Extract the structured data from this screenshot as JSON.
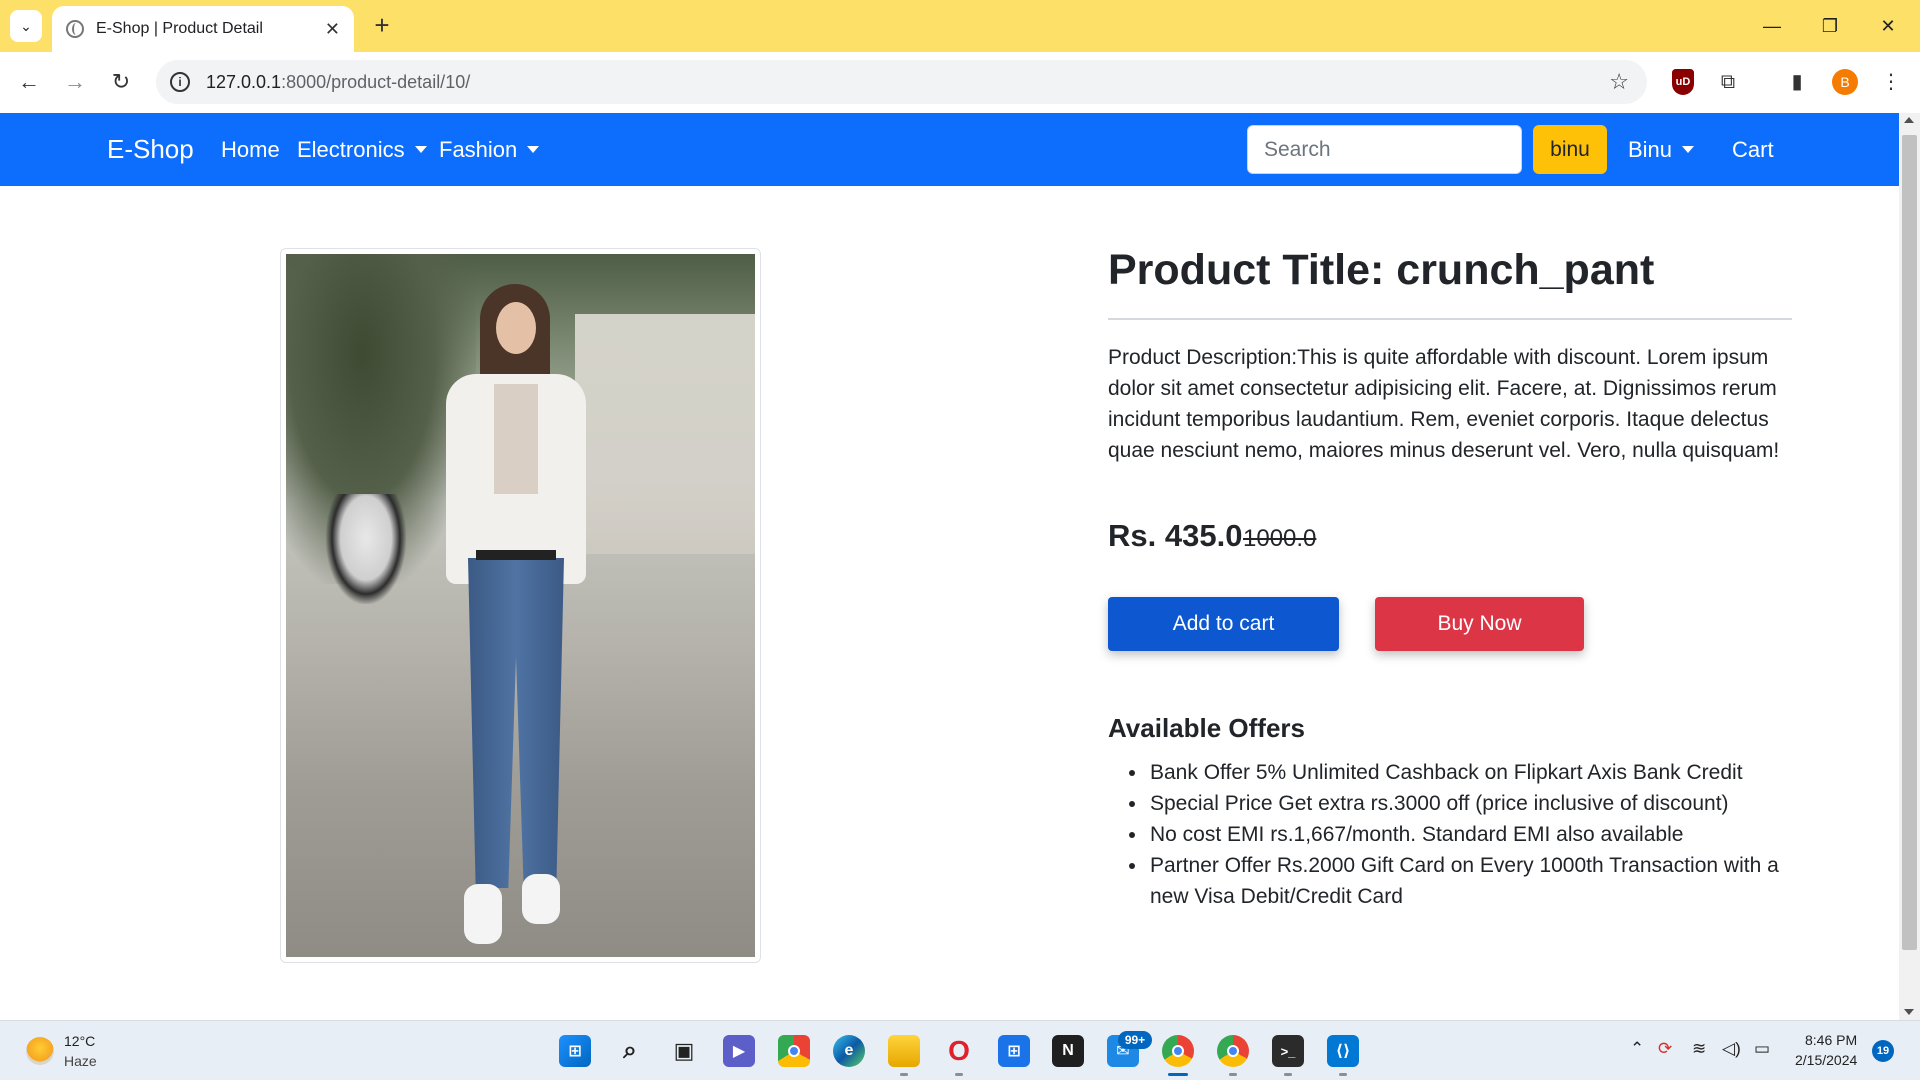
{
  "browser": {
    "tab_title": "E-Shop | Product Detail",
    "tab_close": "✕",
    "new_tab": "+",
    "url_host": "127.0.0.1",
    "url_rest": ":8000/product-detail/10/",
    "profile_initial": "B",
    "ublock_label": "uD",
    "window_controls": {
      "minimize": "—",
      "restore": "❐",
      "close": "✕"
    }
  },
  "navbar": {
    "brand": "E-Shop",
    "links": {
      "home": "Home",
      "electronics": "Electronics",
      "fashion": "Fashion",
      "user": "Binu",
      "cart": "Cart"
    },
    "search_placeholder": "Search",
    "search_button": "binu",
    "bg_color": "#0d6efd"
  },
  "product": {
    "title": "Product Title: crunch_pant",
    "description": "Product Description:This is quite affordable with discount. Lorem ipsum dolor sit amet consectetur adipisicing elit. Facere, at. Dignissimos rerum incidunt temporibus laudantium. Rem, eveniet corporis. Itaque delectus quae nesciunt nemo, maiores minus deserunt vel. Vero, nulla quisquam!",
    "price": "Rs. 435.0",
    "old_price": "1000.0",
    "add_to_cart": "Add to cart",
    "buy_now": "Buy Now",
    "offers_title": "Available Offers",
    "offers": [
      "Bank Offer 5% Unlimited Cashback on Flipkart Axis Bank Credit",
      "Special Price Get extra rs.3000 off (price inclusive of discount)",
      "No cost EMI rs.1,667/month. Standard EMI also available",
      "Partner Offer Rs.2000 Gift Card on Every 1000th Transaction with a new Visa Debit/Credit Card"
    ]
  },
  "taskbar": {
    "weather_temp": "12°C",
    "weather_desc": "Haze",
    "mail_badge": "99+",
    "time": "8:46 PM",
    "date": "2/15/2024",
    "notification_count": "19"
  },
  "colors": {
    "tabbar": "#fde068",
    "add_to_cart": "#0d58d0",
    "buy_now": "#dc3545",
    "search_button": "#ffc107"
  }
}
